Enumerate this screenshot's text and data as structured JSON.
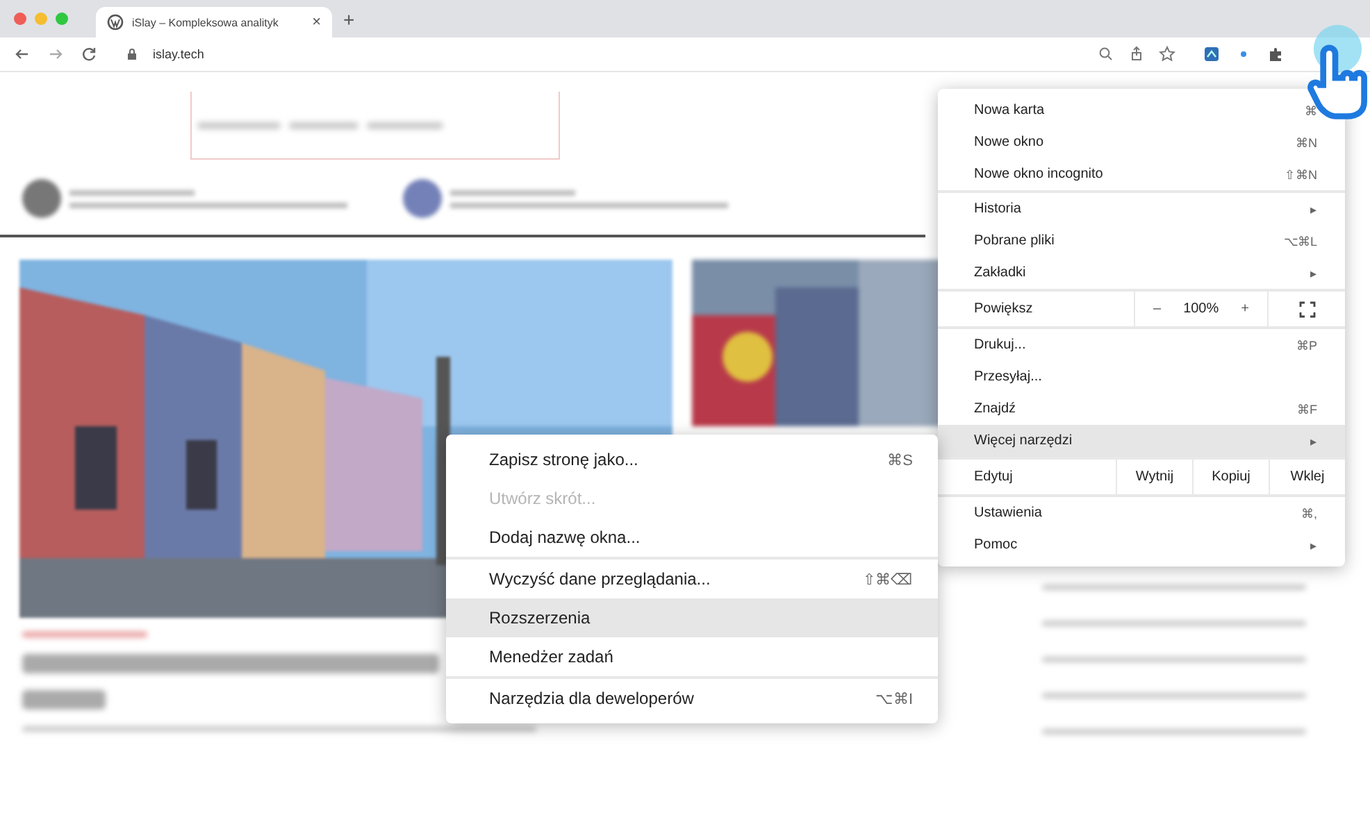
{
  "browser": {
    "tab": {
      "title": "iSlay – Kompleksowa analityk",
      "close": "×"
    },
    "new_tab": "+",
    "address": "islay.tech"
  },
  "menu": {
    "groups": [
      [
        {
          "kind": "item",
          "label": "Nowa karta",
          "shortcut": "⌘",
          "highlighted": false
        },
        {
          "kind": "item",
          "label": "Nowe okno",
          "shortcut": "⌘N",
          "highlighted": false
        },
        {
          "kind": "item",
          "label": "Nowe okno incognito",
          "shortcut": "⇧⌘N",
          "highlighted": false
        }
      ],
      [
        {
          "kind": "submenu",
          "label": "Historia",
          "arrow": "▸",
          "highlighted": false
        },
        {
          "kind": "item",
          "label": "Pobrane pliki",
          "shortcut": "⌥⌘L",
          "highlighted": false
        },
        {
          "kind": "submenu",
          "label": "Zakładki",
          "arrow": "▸",
          "highlighted": false
        }
      ],
      [
        {
          "kind": "zoom",
          "label": "Powiększ",
          "minus": "–",
          "value": "100%",
          "plus": "+"
        }
      ],
      [
        {
          "kind": "item",
          "label": "Drukuj...",
          "shortcut": "⌘P",
          "highlighted": false
        },
        {
          "kind": "item",
          "label": "Przesyłaj...",
          "highlighted": false
        },
        {
          "kind": "item",
          "label": "Znajdź",
          "shortcut": "⌘F",
          "highlighted": false
        },
        {
          "kind": "submenu",
          "label": "Więcej narzędzi",
          "arrow": "▸",
          "highlighted": true
        }
      ],
      [
        {
          "kind": "edit",
          "label": "Edytuj",
          "buttons": [
            "Wytnij",
            "Kopiuj",
            "Wklej"
          ]
        }
      ],
      [
        {
          "kind": "item",
          "label": "Ustawienia",
          "shortcut": "⌘,",
          "highlighted": false
        },
        {
          "kind": "submenu",
          "label": "Pomoc",
          "arrow": "▸",
          "highlighted": false
        }
      ]
    ]
  },
  "submenu": {
    "groups": [
      [
        {
          "label": "Zapisz stronę jako...",
          "shortcut": "⌘S",
          "disabled": false,
          "highlighted": false
        },
        {
          "label": "Utwórz skrót...",
          "disabled": true,
          "highlighted": false
        },
        {
          "label": "Dodaj nazwę okna...",
          "disabled": false,
          "highlighted": false
        }
      ],
      [
        {
          "label": "Wyczyść dane przeglądania...",
          "shortcut": "⇧⌘⌫",
          "disabled": false,
          "highlighted": false
        },
        {
          "label": "Rozszerzenia",
          "disabled": false,
          "highlighted": true
        },
        {
          "label": "Menedżer zadań",
          "disabled": false,
          "highlighted": false
        }
      ],
      [
        {
          "label": "Narzędzia dla deweloperów",
          "shortcut": "⌥⌘I",
          "disabled": false,
          "highlighted": false
        }
      ]
    ]
  }
}
